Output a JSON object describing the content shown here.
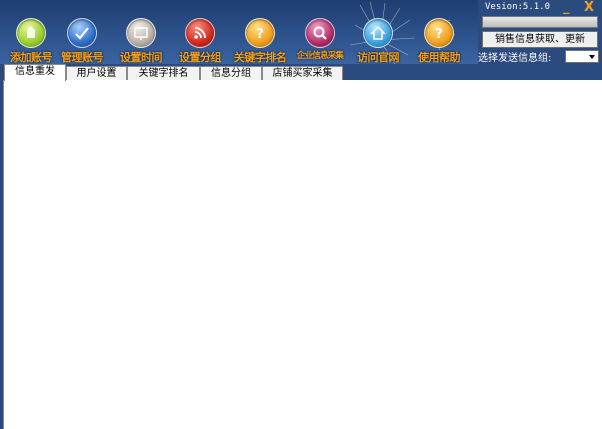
{
  "toolbar": {
    "buttons": [
      {
        "label": "添加账号",
        "color": "#9acd32",
        "icon": "add-account-icon"
      },
      {
        "label": "管理账号",
        "color": "#2f6fc8",
        "icon": "manage-account-icon"
      },
      {
        "label": "设置时间",
        "color": "#b8b0a8",
        "icon": "set-time-icon"
      },
      {
        "label": "设置分组",
        "color": "#d22a1e",
        "icon": "set-group-icon"
      },
      {
        "label": "关键字排名",
        "color": "#f0a020",
        "icon": "keyword-rank-icon"
      },
      {
        "label": "企业信息采集",
        "color": "#b0306a",
        "icon": "enterprise-collect-icon"
      },
      {
        "label": "访问官网",
        "color": "#3aa0e0",
        "icon": "visit-website-icon"
      },
      {
        "label": "使用帮助",
        "color": "#f0a020",
        "icon": "help-icon"
      }
    ]
  },
  "window": {
    "version": "Vesion:5.1.0",
    "minimize": "_",
    "close": "X"
  },
  "side": {
    "fetch_button": "销售信息获取、更新",
    "group_label": "选择发送信息组:",
    "group_value": ""
  },
  "tabs": [
    {
      "label": "信息重发"
    },
    {
      "label": "用户设置"
    },
    {
      "label": "关键字排名"
    },
    {
      "label": "信息分组"
    },
    {
      "label": "店铺买家采集"
    }
  ]
}
